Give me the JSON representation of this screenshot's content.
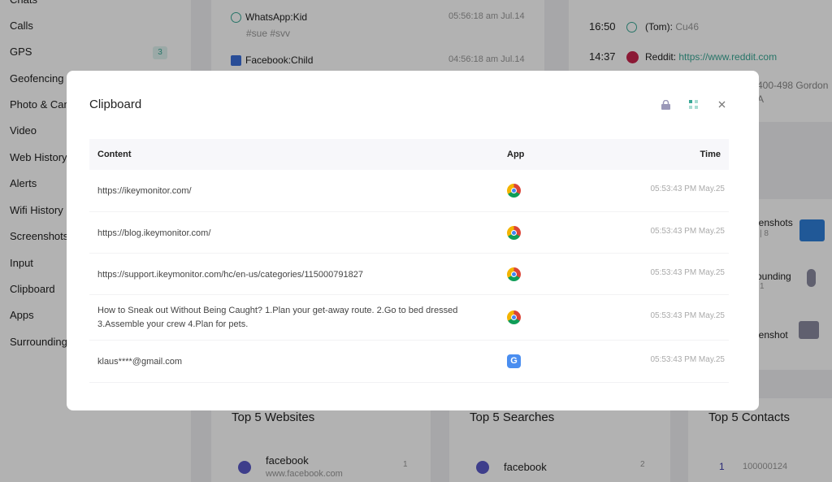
{
  "sidebar": {
    "items": [
      "Chats",
      "Calls",
      "GPS",
      "Geofencing",
      "Photo & Camera",
      "Video",
      "Web History",
      "Alerts",
      "Wifi History",
      "Screenshots",
      "Input",
      "Clipboard",
      "Apps",
      "Surrounding"
    ],
    "gps_badge": "3"
  },
  "messages": [
    {
      "app": "WhatsApp:Kid",
      "time": "05:56:18 am Jul.14",
      "text": "#sue #svv"
    },
    {
      "app": "Facebook:Child",
      "time": "04:56:18 am Jul.14"
    }
  ],
  "timeline": [
    {
      "time": "16:50",
      "who": "(Tom):",
      "text": "Cu46"
    },
    {
      "time": "14:37",
      "who": "Reddit:",
      "link": "https://www.reddit.com"
    }
  ],
  "address": {
    "line1": "400-498 Gordon",
    "line2": "A"
  },
  "right_cards": [
    {
      "label": "eenshots",
      "count": "| 8"
    },
    {
      "label": "rounding",
      "count": "1"
    },
    {
      "label1": "e",
      "label2": "eenshot"
    }
  ],
  "bottom": {
    "websites": {
      "title": "Top 5 Websites",
      "item": "facebook",
      "url": "www.facebook.com",
      "count": "1"
    },
    "searches": {
      "title": "Top 5 Searches",
      "item": "facebook",
      "count": "2"
    },
    "contacts": {
      "title": "Top 5 Contacts",
      "rank": "1",
      "item": "100000124"
    }
  },
  "modal": {
    "title": "Clipboard",
    "columns": {
      "content": "Content",
      "app": "App",
      "time": "Time"
    },
    "rows": [
      {
        "content": "https://ikeymonitor.com/",
        "app": "chrome",
        "time": "05:53:43 PM May.25"
      },
      {
        "content": "https://blog.ikeymonitor.com/",
        "app": "chrome",
        "time": "05:53:43 PM May.25"
      },
      {
        "content": "https://support.ikeymonitor.com/hc/en-us/categories/115000791827",
        "app": "chrome",
        "time": "05:53:43 PM May.25"
      },
      {
        "content": "How to Sneak out Without Being Caught? 1.Plan your get-away route. 2.Go to bed dressed 3.Assemble your crew 4.Plan for pets.",
        "app": "chrome",
        "time": "05:53:43 PM May.25"
      },
      {
        "content": "klaus****@gmail.com",
        "app": "google",
        "time": "05:53:43 PM May.25"
      }
    ]
  },
  "colors": {
    "accent": "#3aa896",
    "lock": "#9a98b8",
    "google": "#4a8ef0"
  }
}
